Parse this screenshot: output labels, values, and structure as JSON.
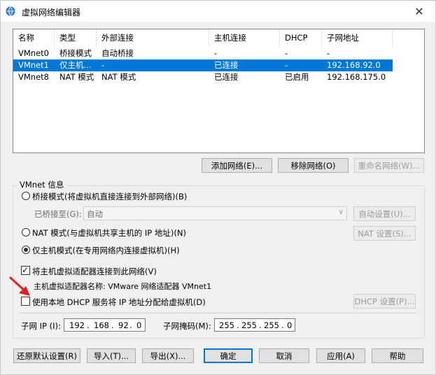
{
  "window": {
    "title": "虚拟网络编辑器",
    "close_glyph": "✕"
  },
  "list": {
    "columns": [
      "名称",
      "类型",
      "外部连接",
      "主机连接",
      "DHCP",
      "子网地址"
    ],
    "rows": [
      {
        "name": "VMnet0",
        "type": "桥接模式",
        "external": "自动桥接",
        "host": "-",
        "dhcp": "-",
        "subnet": "-",
        "selected": false
      },
      {
        "name": "VMnet1",
        "type": "仅主机...",
        "external": "-",
        "host": "已连接",
        "dhcp": "-",
        "subnet": "192.168.92.0",
        "selected": true
      },
      {
        "name": "VMnet8",
        "type": "NAT 模式",
        "external": "NAT 模式",
        "host": "已连接",
        "dhcp": "已启用",
        "subnet": "192.168.175.0",
        "selected": false
      }
    ]
  },
  "list_buttons": {
    "add": "添加网络(E)...",
    "remove": "移除网络(O)",
    "rename": "重命名网络(W)..."
  },
  "vmnet_info": {
    "label": "VMnet 信息",
    "bridge_radio": "桥接模式(将虚拟机直接连接到外部网络)(B)",
    "bridged_to_label": "已桥接至(G):",
    "bridged_to_value": "自动",
    "auto_settings": "自动设置(U)...",
    "nat_radio": "NAT 模式(与虚拟机共享主机的 IP 地址)(N)",
    "nat_settings": "NAT 设置(S)...",
    "hostonly_radio": "仅主机模式(在专用网络内连接虚拟机)(H)",
    "selected_mode": "hostonly",
    "connect_adapter_check": "将主机虚拟适配器连接到此网络(V)",
    "connect_adapter_checked": true,
    "adapter_name_line": "主机虚拟适配器名称: VMware 网络适配器 VMnet1",
    "dhcp_check": "使用本地 DHCP 服务将 IP 地址分配给虚拟机(D)",
    "dhcp_checked": false,
    "dhcp_settings": "DHCP 设置(P)...",
    "subnet_ip_label": "子网 IP (I):",
    "subnet_ip": [
      "192",
      "168",
      "92",
      "0"
    ],
    "subnet_mask_label": "子网掩码(M):",
    "subnet_mask": [
      "255",
      "255",
      "255",
      "0"
    ],
    "dot": "."
  },
  "footer_buttons": {
    "restore": "还原默认设置(R)",
    "import": "导入(T)...",
    "export": "导出(X)...",
    "ok": "确定",
    "cancel": "取消",
    "apply": "应用(A)",
    "help": "帮助"
  },
  "colors": {
    "selection": "#0078d7",
    "arrow": "#e0201b"
  },
  "icons": {
    "title": "network-globe-icon",
    "annotation": "red-arrow-icon"
  }
}
